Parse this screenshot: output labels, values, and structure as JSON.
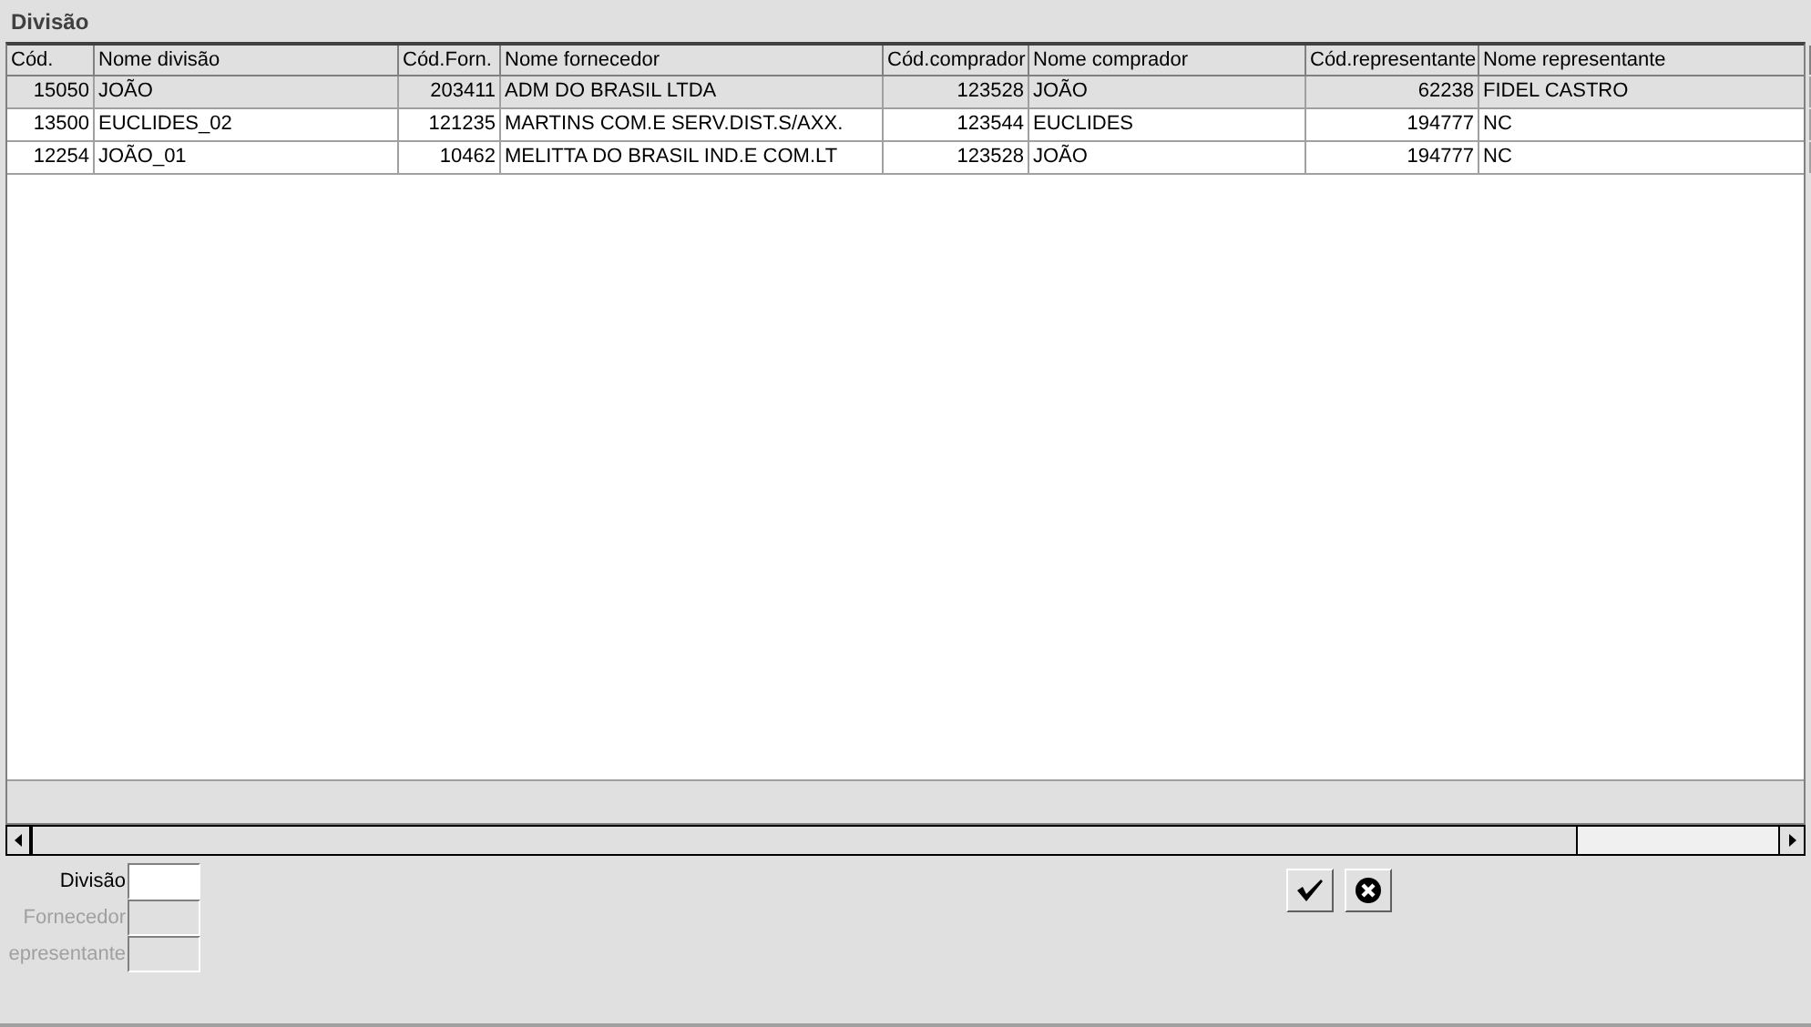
{
  "title": "Divisão",
  "table": {
    "columns": [
      {
        "label": "Cód.",
        "kind": "number"
      },
      {
        "label": "Nome divisão",
        "kind": "text"
      },
      {
        "label": "Cód.Forn.",
        "kind": "number"
      },
      {
        "label": "Nome fornecedor",
        "kind": "text"
      },
      {
        "label": "Cód.comprador",
        "kind": "number"
      },
      {
        "label": "Nome comprador",
        "kind": "text"
      },
      {
        "label": "Cód.representante",
        "kind": "number"
      },
      {
        "label": "Nome representante",
        "kind": "text"
      }
    ],
    "rows": [
      {
        "selected": true,
        "cells": [
          "15050",
          "JOÃO",
          "203411",
          "ADM DO BRASIL LTDA",
          "123528",
          "JOÃO",
          "62238",
          "FIDEL CASTRO"
        ]
      },
      {
        "selected": false,
        "cells": [
          "13500",
          "EUCLIDES_02",
          "121235",
          "MARTINS COM.E SERV.DIST.S/AXX.",
          "123544",
          "EUCLIDES",
          "194777",
          "NC"
        ]
      },
      {
        "selected": false,
        "cells": [
          "12254",
          "JOÃO_01",
          "10462",
          "MELITTA DO BRASIL IND.E COM.LT",
          "123528",
          "JOÃO",
          "194777",
          "NC"
        ]
      }
    ]
  },
  "filters": [
    {
      "label": "Divisão",
      "disabled": false
    },
    {
      "label": "Fornecedor",
      "disabled": true
    },
    {
      "label": "epresentante",
      "disabled": true
    }
  ]
}
